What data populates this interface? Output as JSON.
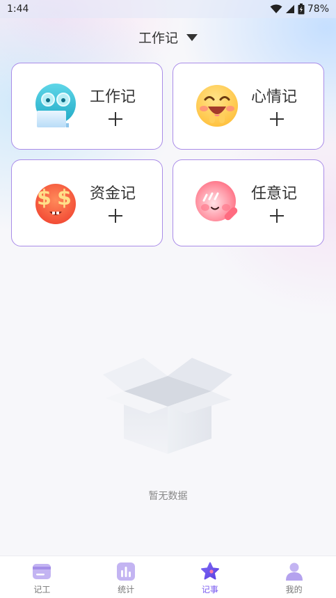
{
  "status_bar": {
    "time": "1:44",
    "battery": "78%"
  },
  "header": {
    "title": "工作记"
  },
  "cards": [
    {
      "label": "工作记",
      "icon": "work-emoji-icon"
    },
    {
      "label": "心情记",
      "icon": "mood-emoji-icon"
    },
    {
      "label": "资金记",
      "icon": "money-emoji-icon"
    },
    {
      "label": "任意记",
      "icon": "any-emoji-icon"
    }
  ],
  "empty_state": {
    "text": "暂无数据"
  },
  "nav": {
    "items": [
      {
        "label": "记工",
        "icon": "wallet-icon",
        "active": false
      },
      {
        "label": "统计",
        "icon": "chart-icon",
        "active": false
      },
      {
        "label": "记事",
        "icon": "star-icon",
        "active": true
      },
      {
        "label": "我的",
        "icon": "user-icon",
        "active": false
      }
    ]
  },
  "colors": {
    "accent": "#7b5cf0",
    "card_border": "#a98be8"
  }
}
